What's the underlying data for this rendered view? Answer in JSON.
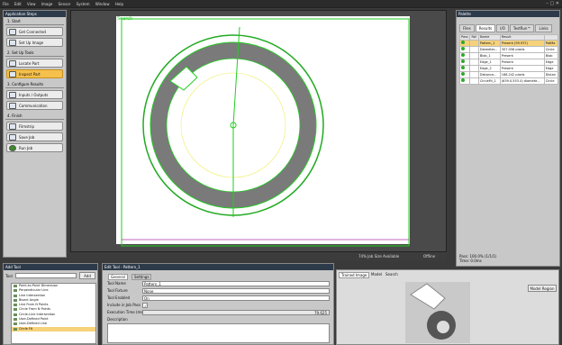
{
  "menu": {
    "items": [
      "File",
      "Edit",
      "View",
      "Image",
      "Sensor",
      "System",
      "Window",
      "Help"
    ]
  },
  "steps": {
    "title": "Application Steps",
    "sections": [
      {
        "label": "1. Start",
        "buttons": [
          {
            "label": "Get Connected"
          },
          {
            "label": "Set Up Image"
          }
        ]
      },
      {
        "label": "2. Set Up Tools",
        "buttons": [
          {
            "label": "Locate Part"
          },
          {
            "label": "Inspect Part",
            "selected": true
          }
        ]
      },
      {
        "label": "3. Configure Results",
        "buttons": [
          {
            "label": "Inputs / Outputs"
          },
          {
            "label": "Communication"
          }
        ]
      },
      {
        "label": "4. Finish",
        "buttons": [
          {
            "label": "Filmstrip"
          },
          {
            "label": "Save Job"
          },
          {
            "label": "Run Job"
          }
        ]
      }
    ]
  },
  "viewer": {
    "region_label": "Search",
    "status": {
      "job_size": "74% Job Size Available",
      "mode": "Offline"
    }
  },
  "palette": {
    "title": "Palette",
    "tabs": [
      "Files",
      "Results",
      "I/O",
      "TestRun™",
      "Links"
    ],
    "active_tab": "Results",
    "columns": [
      "Pass",
      "Fail",
      "Name",
      "Result",
      ""
    ],
    "rows": [
      {
        "name": "Pattern_1",
        "result": "Present (99.937)",
        "type": "PatMa",
        "selected": true
      },
      {
        "name": "Diameter...",
        "result": "307.056 pixels",
        "type": "Circle"
      },
      {
        "name": "Blob_1",
        "result": "Present",
        "type": "Blob"
      },
      {
        "name": "Edge_1",
        "result": "Present",
        "type": "Edge"
      },
      {
        "name": "Edge_2",
        "result": "Present",
        "type": "Edge"
      },
      {
        "name": "Distance...",
        "result": "168.242 pixels",
        "type": "Distan"
      },
      {
        "name": "CircleFit_1",
        "result": "(639.0,553.4) diamete...",
        "type": "Circle"
      }
    ],
    "pass": "Pass: 100.0% (1/1/1)",
    "time": "Time: 0.0ms"
  },
  "addtool": {
    "title": "Add Tool",
    "tool_label": "Tool",
    "add_button": "Add",
    "items": [
      "Point-to-Point Dimension",
      "Perpendicular Line",
      "Line Intersection",
      "Bisect Angle",
      "Line From N Points",
      "Circle From N Points",
      "Circle-Line Intersection",
      "User-Defined Point",
      "User-Defined Line",
      "Circle Fit"
    ],
    "selected": "Circle Fit"
  },
  "edittool": {
    "title": "Edit Tool - Pattern_1",
    "tabs": [
      "General",
      "Settings"
    ],
    "fields": [
      {
        "label": "Tool Name",
        "value": "Pattern_1"
      },
      {
        "label": "Tool Fixture",
        "value": "None"
      },
      {
        "label": "Tool Enabled",
        "value": "On"
      },
      {
        "label": "Include in Job Pass",
        "value": "✓"
      },
      {
        "label": "Execution Time (ms)",
        "value": "79.625"
      },
      {
        "label": "Description",
        "value": ""
      }
    ]
  },
  "trained": {
    "tabs": [
      "Trained Image",
      "Model",
      "Search"
    ],
    "model_region_button": "Model Region"
  },
  "colors": {
    "accent": "#f5c14c",
    "overlay": "#22cc22",
    "tool": "#ffff66"
  }
}
